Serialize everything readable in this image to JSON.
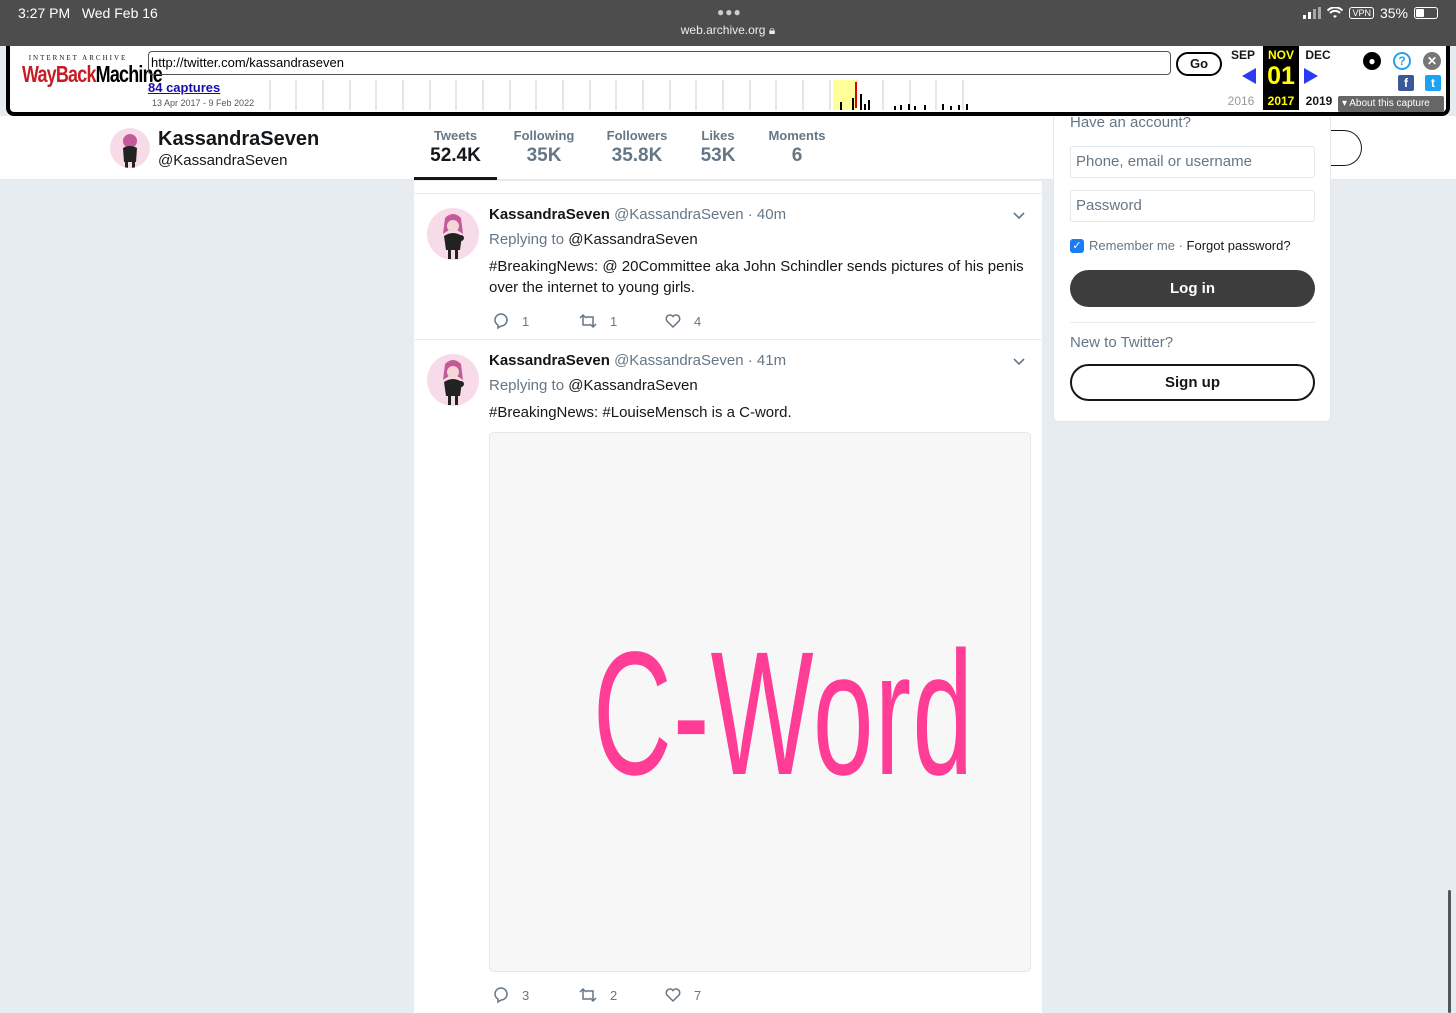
{
  "statusbar": {
    "time": "3:27 PM",
    "date": "Wed Feb 16",
    "url": "web.archive.org",
    "vpn": "VPN",
    "battery": "35%"
  },
  "wayback": {
    "logo_top": "INTERNET ARCHIVE",
    "logo_main": "WaybackMachine",
    "url_value": "http://twitter.com/kassandraseven",
    "go_label": "Go",
    "captures": "84 captures",
    "range": "13 Apr 2017 - 9 Feb 2022",
    "prev_month": "SEP",
    "cur_month": "NOV",
    "next_month": "DEC",
    "cur_day": "01",
    "prev_year": "2016",
    "cur_year": "2017",
    "next_year": "2019",
    "about": "About this capture"
  },
  "profile": {
    "name": "KassandraSeven",
    "handle": "@KassandraSeven",
    "stats": [
      {
        "label": "Tweets",
        "value": "52.4K"
      },
      {
        "label": "Following",
        "value": "35K"
      },
      {
        "label": "Followers",
        "value": "35.8K"
      },
      {
        "label": "Likes",
        "value": "53K"
      },
      {
        "label": "Moments",
        "value": "6"
      }
    ]
  },
  "tweets": [
    {
      "name": "KassandraSeven",
      "meta": "@KassandraSeven · 40m",
      "replying_label": "Replying to",
      "replying_to": "@KassandraSeven",
      "text": "#BreakingNews: @ 20Committee aka John Schindler sends pictures of his penis over the internet to young girls.",
      "replies": "1",
      "retweets": "1",
      "likes": "4"
    },
    {
      "name": "KassandraSeven",
      "meta": "@KassandraSeven · 41m",
      "replying_label": "Replying to",
      "replying_to": "@KassandraSeven",
      "text": "#BreakingNews: #LouiseMensch is a C-word.",
      "media_text": "C-Word",
      "replies": "3",
      "retweets": "2",
      "likes": "7"
    }
  ],
  "login": {
    "have_account": "Have an account?",
    "username_placeholder": "Phone, email or username",
    "password_placeholder": "Password",
    "remember": "Remember me",
    "dot": " · ",
    "forgot": "Forgot password?",
    "login_label": "Log in",
    "new_to": "New to Twitter?",
    "signup_label": "Sign up"
  },
  "colors": {
    "accent": "#ff3c96",
    "wayback_red": "#c41e24",
    "checkbox": "#1b7cf5"
  }
}
